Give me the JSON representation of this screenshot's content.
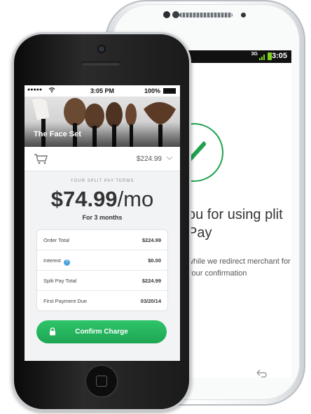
{
  "android": {
    "network_label": "3G",
    "status_time": "3:05",
    "thank_you_text": "ou for using plit Pay",
    "redirect_text": "while we redirect merchant for your confirmation",
    "icons": {
      "check": "checkmark-icon",
      "back": "back-arrow-icon",
      "home": "home-icon",
      "signal": "signal-icon",
      "battery": "battery-icon"
    },
    "accent_color": "#1fa24e"
  },
  "iphone": {
    "status": {
      "time": "3:05 PM",
      "battery_percent": "100%"
    },
    "product": {
      "title": "The Face Set",
      "price": "$224.99"
    },
    "terms": {
      "label": "YOUR SPLIT PAY TERMS",
      "amount": "$74.99",
      "per": "/mo",
      "duration": "For 3 months"
    },
    "summary": [
      {
        "label": "Order Total",
        "value": "$224.99"
      },
      {
        "label": "Interest",
        "value": "$0.00"
      },
      {
        "label": "Split Pay Total",
        "value": "$224.99"
      },
      {
        "label": "First Payment Due",
        "value": "03/20/14"
      }
    ],
    "confirm_label": "Confirm Charge",
    "icons": {
      "cart": "cart-icon",
      "chevron": "chevron-down-icon",
      "lock": "lock-icon",
      "info": "info-icon",
      "wifi": "wifi-icon",
      "battery": "battery-icon"
    },
    "button_color": "#22b25c"
  }
}
